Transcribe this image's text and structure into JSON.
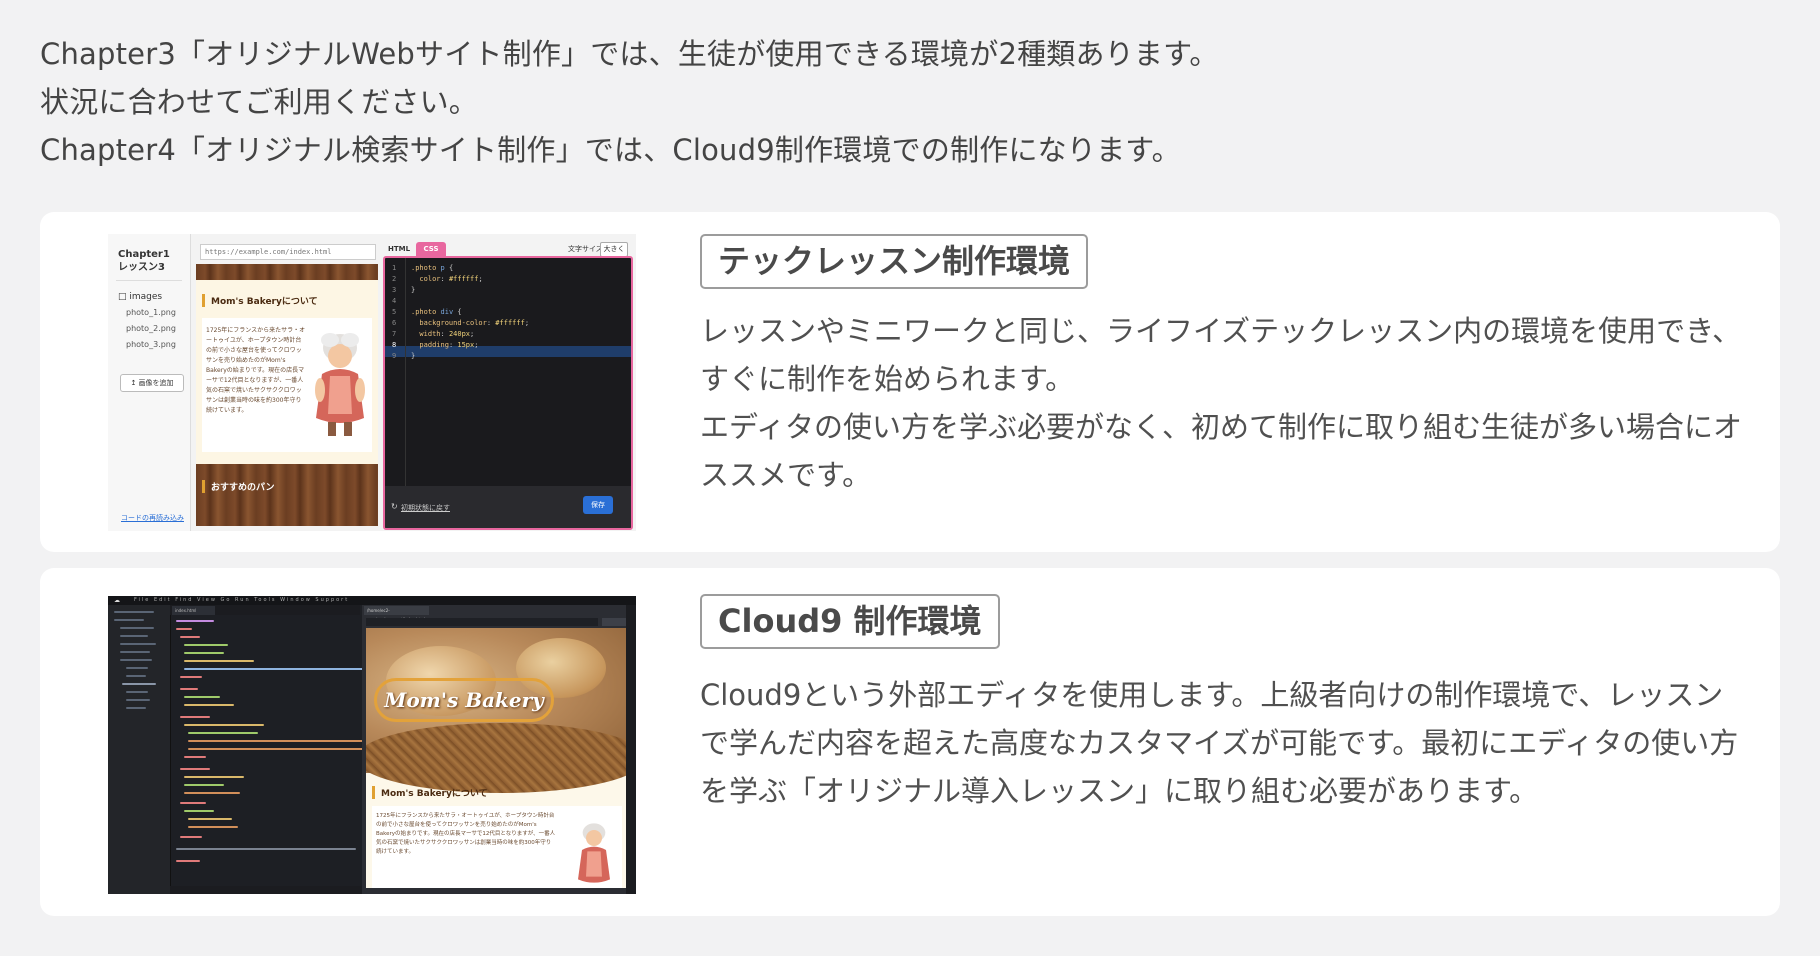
{
  "intro": {
    "line1": "Chapter3「オリジナルWebサイト制作」では、生徒が使用できる環境が2種類あります。",
    "line2": "状況に合わせてご利用ください。",
    "line3": "Chapter4「オリジナル検索サイト制作」では、Cloud9制作環境での制作になります。"
  },
  "tech": {
    "title": "テックレッスン制作環境",
    "body1": "レッスンやミニワークと同じ、ライフイズテックレッスン内の環境を使用でき、すぐに制作を始められます。",
    "body2": "エディタの使い方を学ぶ必要がなく、初めて制作に取り組む生徒が多い場合にオススメです。",
    "mock": {
      "chapter_line1": "Chapter1",
      "chapter_line2": "レッスン3",
      "folder": "images",
      "files": [
        "photo_1.png",
        "photo_2.png",
        "photo_3.png"
      ],
      "add_image": "画像を追加",
      "reload_code": "コードの再読み込み",
      "url": "https://example.com/index.html",
      "page_heading": "Mom's Bakeryについて",
      "page_text": "1725年にフランスから来たサラ・オートゥイユが、ホープタウン時計台の前で小さな屋台を使ってクロワッサンを売り始めたのがMom's Bakeryの始まりです。現在の店長マーサで12代目となりますが、一番人気の石窯で焼いたサクサククロワッサンは創業当時の味を約300年守り続けています。",
      "page_heading2": "おすすめのパン",
      "tab_html": "HTML",
      "tab_css": "CSS",
      "font_size_label": "文字サイズ",
      "font_size_value": "大きく",
      "line_numbers": [
        "1",
        "2",
        "3",
        "4",
        "5",
        "6",
        "7",
        "8",
        "9"
      ],
      "reset": "初期状態に戻す",
      "save": "保存"
    }
  },
  "cloud9": {
    "title": "Cloud9 制作環境",
    "body1": "Cloud9という外部エディタを使用します。上級者向けの制作環境で、レッスンで学んだ内容を超えた高度なカスタマイズが可能です。最初にエディタの使い方を学ぶ「オリジナル導入レッスン」に取り組む必要があります。",
    "mock": {
      "menu": "File Edit Find View Go Run Tools Window Support",
      "editor_tab": "index.html",
      "preview_tab": "/home/ec2-user/environment/index.html",
      "brand": "Mom's Bakery",
      "page_heading": "Mom's Bakeryについて",
      "page_text": "1725年にフランスから来たサラ・オートゥイユが、ホープタウン時計台の前で小さな屋台を使ってクロワッサンを売り始めたのがMom's Bakeryの始まりです。現在の店長マーサで12代目となりますが、一番人気の石窯で焼いたサクサククロワッサンは創業当時の味を約300年守り続けています。"
    }
  }
}
